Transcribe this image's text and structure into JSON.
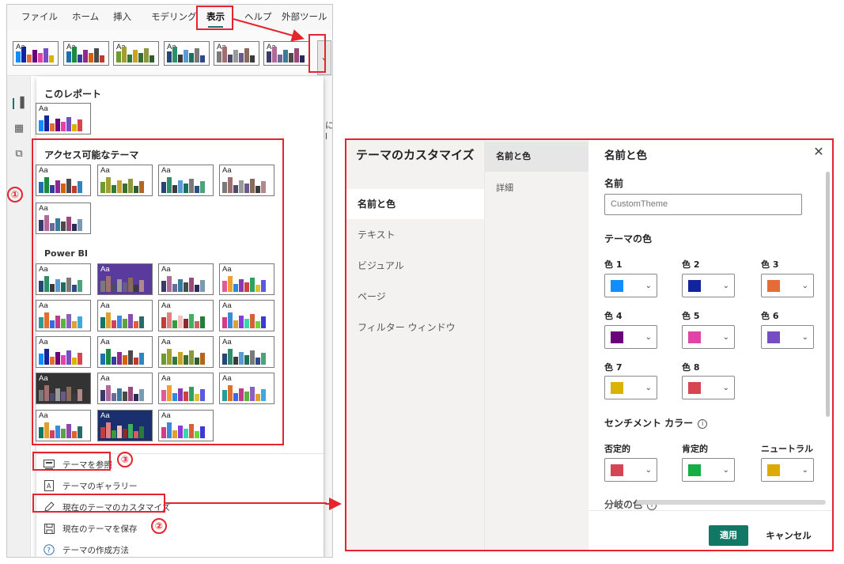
{
  "ribbon": {
    "tabs": [
      "ファイル",
      "ホーム",
      "挿入",
      "モデリング",
      "表示",
      "ヘルプ",
      "外部ツール"
    ],
    "active_tab": "表示",
    "expand_icon": "chevron-down-icon"
  },
  "canvas_text": "にl",
  "gallery": {
    "section_this_report": "このレポート",
    "section_accessible": "アクセス可能なテーマ",
    "section_powerbi": "Power BI",
    "thumb_text": "Aa",
    "menu": [
      {
        "label": "テーマを参照",
        "icon": "browse-theme-icon"
      },
      {
        "label": "テーマのギャラリー",
        "icon": "theme-gallery-icon"
      },
      {
        "label": "現在のテーマのカスタマイズ",
        "icon": "customize-pen-icon"
      },
      {
        "label": "現在のテーマを保存",
        "icon": "save-icon"
      },
      {
        "label": "テーマの作成方法",
        "icon": "help-circle-icon"
      }
    ]
  },
  "annotations": {
    "num1": "①",
    "num2": "②",
    "num3": "③"
  },
  "dialog": {
    "title": "テーマのカスタマイズ",
    "nav": [
      "名前と色",
      "テキスト",
      "ビジュアル",
      "ページ",
      "フィルター ウィンドウ"
    ],
    "active_nav": "名前と色",
    "subnav": [
      "名前と色",
      "詳細"
    ],
    "main_title": "名前と色",
    "name_label": "名前",
    "name_placeholder": "CustomTheme",
    "theme_colors_label": "テーマの色",
    "colors": [
      {
        "label": "色 1",
        "hex": "#118DFF"
      },
      {
        "label": "色 2",
        "hex": "#12239E"
      },
      {
        "label": "色 3",
        "hex": "#E66C37"
      },
      {
        "label": "色 4",
        "hex": "#6B007B"
      },
      {
        "label": "色 5",
        "hex": "#E044A7"
      },
      {
        "label": "色 6",
        "hex": "#744EC2"
      },
      {
        "label": "色 7",
        "hex": "#D9B300"
      },
      {
        "label": "色 8",
        "hex": "#D64550"
      }
    ],
    "sentiment_label": "センチメント カラー",
    "sentiment": [
      {
        "label": "否定的",
        "hex": "#D64554"
      },
      {
        "label": "肯定的",
        "hex": "#15AE44"
      },
      {
        "label": "ニュートラル",
        "hex": "#DDAA00"
      }
    ],
    "divergent_label": "分岐の色",
    "apply": "適用",
    "cancel": "キャンセル",
    "close_icon": "close-icon"
  },
  "colors": {
    "accent": "#117865",
    "annotation_red": "#E6242E"
  }
}
